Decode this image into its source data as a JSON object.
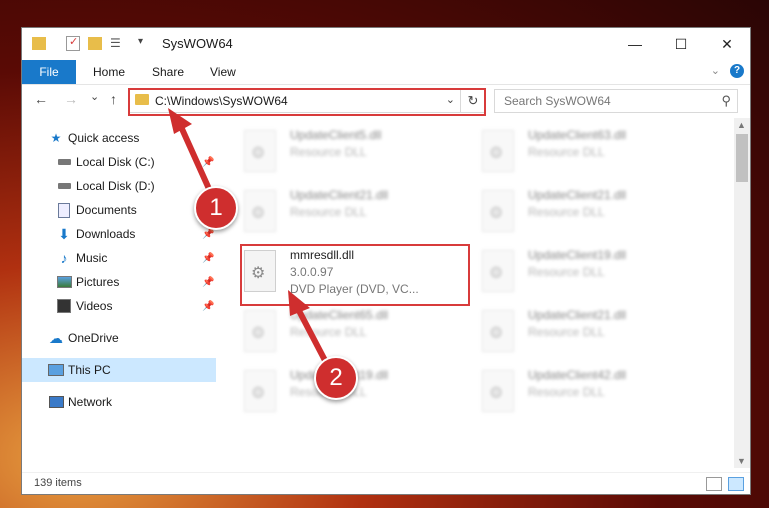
{
  "window": {
    "title": "SysWOW64",
    "controls": {
      "minimize": "—",
      "maximize": "☐",
      "close": "✕"
    }
  },
  "ribbon": {
    "tabs": [
      "File",
      "Home",
      "Share",
      "View"
    ],
    "help": "?"
  },
  "navigation": {
    "back": "←",
    "forward": "→",
    "recent": "⌄",
    "up": "↑",
    "address": "C:\\Windows\\SysWOW64",
    "refresh": "↻",
    "search_placeholder": "Search SysWOW64"
  },
  "sidebar": {
    "items": [
      {
        "label": "Quick access",
        "icon": "star-icon",
        "pinned": false
      },
      {
        "label": "Local Disk (C:)",
        "icon": "drive-icon",
        "pinned": true
      },
      {
        "label": "Local Disk (D:)",
        "icon": "drive-icon",
        "pinned": false
      },
      {
        "label": "Documents",
        "icon": "documents-icon",
        "pinned": true
      },
      {
        "label": "Downloads",
        "icon": "downloads-icon",
        "pinned": true
      },
      {
        "label": "Music",
        "icon": "music-icon",
        "pinned": true
      },
      {
        "label": "Pictures",
        "icon": "pictures-icon",
        "pinned": true
      },
      {
        "label": "Videos",
        "icon": "videos-icon",
        "pinned": true
      },
      {
        "label": "OneDrive",
        "icon": "cloud-icon",
        "pinned": false
      },
      {
        "label": "This PC",
        "icon": "computer-icon",
        "pinned": false,
        "selected": true
      },
      {
        "label": "Network",
        "icon": "network-icon",
        "pinned": false
      }
    ]
  },
  "files": {
    "left": [
      {
        "name": "UpdateClient5.dll",
        "type": "Resource DLL"
      },
      {
        "name": "UpdateClient21.dll",
        "type": "Resource DLL"
      },
      {
        "name": "mmresdll.dll",
        "version": "3.0.0.97",
        "type": "DVD Player (DVD, VC...",
        "highlighted": true
      },
      {
        "name": "UpdateClient65.dll",
        "type": "Resource DLL"
      },
      {
        "name": "UpdateClient19.dll",
        "type": "Resource DLL"
      }
    ],
    "right": [
      {
        "name": "UpdateClient63.dll",
        "type": "Resource DLL"
      },
      {
        "name": "UpdateClient21.dll",
        "type": "Resource DLL"
      },
      {
        "name": "UpdateClient19.dll",
        "type": "Resource DLL"
      },
      {
        "name": "UpdateClient21.dll",
        "type": "Resource DLL"
      },
      {
        "name": "UpdateClient42.dll",
        "type": "Resource DLL"
      }
    ]
  },
  "status": {
    "item_count": "139 items"
  },
  "callouts": {
    "one": "1",
    "two": "2"
  },
  "colors": {
    "accent": "#1979ca",
    "callout_red": "#cf2e2e",
    "selection": "#cce8ff"
  }
}
